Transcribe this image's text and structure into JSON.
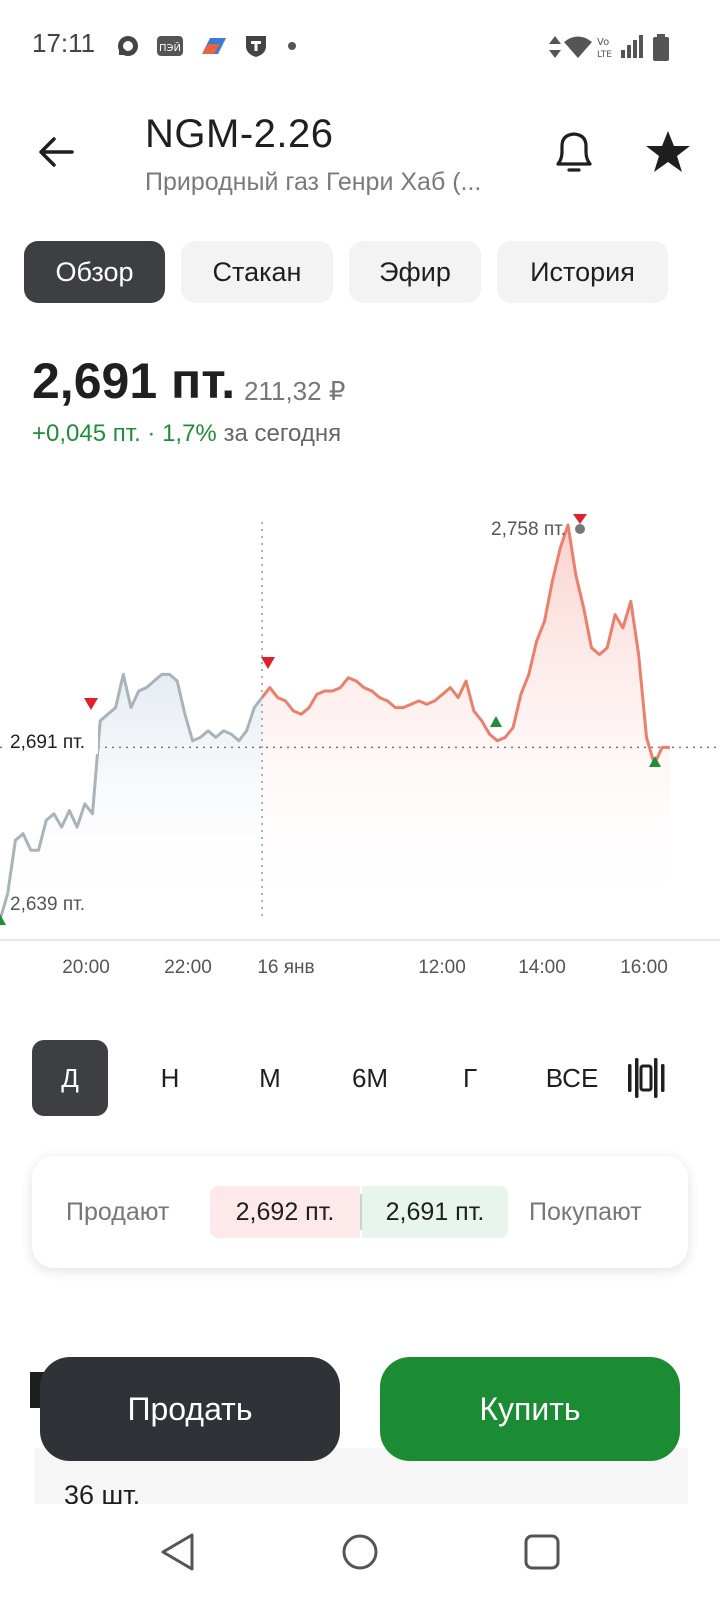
{
  "status_bar": {
    "time": "17:11",
    "left_icons": [
      "chat-bubble-icon",
      "pei-app-icon",
      "bank-app-icon",
      "t-shield-icon",
      "dot-icon"
    ],
    "right_icons": [
      "data-arrows-icon",
      "wifi-icon",
      "volte-icon",
      "signal-icon",
      "battery-icon"
    ]
  },
  "header": {
    "title": "NGM-2.26",
    "subtitle": "Природный газ Генри Хаб (...",
    "back_icon": "arrow-left-icon",
    "bell_icon": "bell-icon",
    "star_icon": "star-icon"
  },
  "tabs": [
    {
      "label": "Обзор",
      "active": true
    },
    {
      "label": "Стакан",
      "active": false
    },
    {
      "label": "Эфир",
      "active": false
    },
    {
      "label": "История",
      "active": false
    }
  ],
  "price": {
    "main": "2,691 пт.",
    "rub": "211,32 ₽",
    "change": "+0,045 пт. · 1,7%",
    "change_suffix": "за сегодня"
  },
  "chart": {
    "current_label": "2,691 пт.",
    "high_label": "2,758 пт.",
    "low_label": "2,639 пт.",
    "x_labels": [
      "20:00",
      "22:00",
      "16 янв",
      "12:00",
      "14:00",
      "16:00"
    ],
    "colors": {
      "previous_session": "#a9b4ba",
      "current_session": "#ec7f6c",
      "up_marker": "#1f8d3a",
      "down_marker": "#e0202a"
    }
  },
  "chart_data": {
    "type": "line",
    "x_tick_labels": [
      "20:00",
      "22:00",
      "16 янв",
      "12:00",
      "14:00",
      "16:00"
    ],
    "current_value": 2.691,
    "high": 2.758,
    "low": 2.639,
    "unit": "пт.",
    "previous_session_values": [
      2.639,
      2.647,
      2.663,
      2.665,
      2.66,
      2.66,
      2.669,
      2.671,
      2.667,
      2.672,
      2.667,
      2.674,
      2.671,
      2.699,
      2.701,
      2.703,
      2.713,
      2.703,
      2.708,
      2.709,
      2.711,
      2.713,
      2.713,
      2.711,
      2.701,
      2.693,
      2.694,
      2.696,
      2.694,
      2.696,
      2.695,
      2.693,
      2.696,
      2.703,
      2.706
    ],
    "current_session_values": [
      2.706,
      2.709,
      2.706,
      2.705,
      2.702,
      2.701,
      2.703,
      2.707,
      2.708,
      2.708,
      2.709,
      2.712,
      2.711,
      2.709,
      2.708,
      2.706,
      2.705,
      2.703,
      2.703,
      2.704,
      2.705,
      2.704,
      2.705,
      2.707,
      2.709,
      2.706,
      2.711,
      2.702,
      2.699,
      2.695,
      2.693,
      2.694,
      2.697,
      2.707,
      2.713,
      2.723,
      2.729,
      2.741,
      2.751,
      2.758,
      2.743,
      2.733,
      2.721,
      2.719,
      2.721,
      2.731,
      2.727,
      2.735,
      2.719,
      2.694,
      2.686,
      2.691,
      2.691
    ]
  },
  "periods": [
    {
      "label": "Д",
      "active": true
    },
    {
      "label": "Н",
      "active": false
    },
    {
      "label": "М",
      "active": false
    },
    {
      "label": "6М",
      "active": false
    },
    {
      "label": "Г",
      "active": false
    },
    {
      "label": "ВСЕ",
      "active": false
    }
  ],
  "chart_type_icon": "candlestick-icon",
  "order_book": {
    "sell_label": "Продают",
    "ask": "2,692 пт.",
    "bid": "2,691 пт.",
    "buy_label": "Покупают"
  },
  "position": {
    "quantity": "36 шт."
  },
  "actions": {
    "sell": "Продать",
    "buy": "Купить"
  },
  "nav": {
    "back_icon": "nav-back-triangle-icon",
    "home_icon": "nav-home-circle-icon",
    "recents_icon": "nav-recents-square-icon"
  }
}
